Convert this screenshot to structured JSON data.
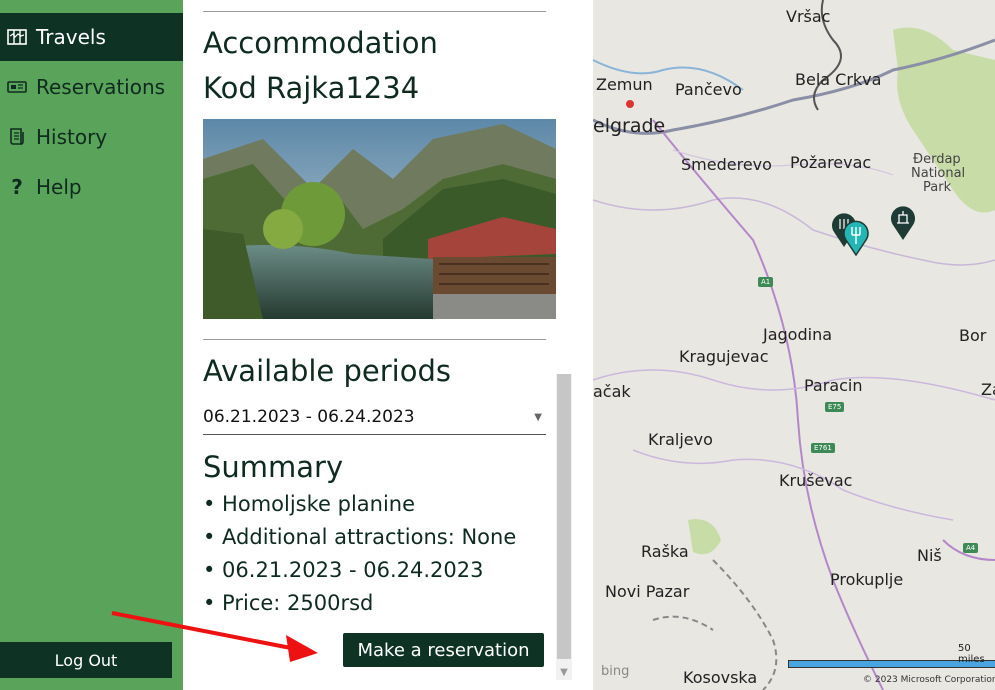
{
  "sidebar": {
    "items": [
      {
        "label": "Travels",
        "icon": "map-icon",
        "active": true
      },
      {
        "label": "Reservations",
        "icon": "ticket-icon"
      },
      {
        "label": "History",
        "icon": "scroll-icon"
      },
      {
        "label": "Help",
        "icon": "question-icon"
      }
    ],
    "logout_label": "Log Out"
  },
  "details": {
    "section_title": "Accommodation",
    "accommodation_name": "Kod Rajka1234",
    "periods_title": "Available periods",
    "selected_period": "06.21.2023 - 06.24.2023",
    "summary_title": "Summary",
    "summary_lines": [
      "• Homoljske planine",
      "• Additional attractions: None",
      "• 06.21.2023 - 06.24.2023",
      "• Price: 2500rsd"
    ],
    "reserve_label": "Make a reservation"
  },
  "map": {
    "labels": [
      "Vršac",
      "Zemun",
      "Pančevo",
      "Bela Crkva",
      "elgrade",
      "Smederevo",
      "Požarevac",
      "Đerdap",
      "National",
      "Park",
      "A1",
      "Jagodina",
      "Bor",
      "Kragujevac",
      "Paracin",
      "ačak",
      "E75",
      "Kraljevo",
      "E761",
      "Kruševac",
      "Raška",
      "Niš",
      "A4",
      "Prokuplje",
      "Novi Pazar",
      "Kosovska",
      "Za"
    ],
    "attribution": "© 2023 Microsoft Corporation",
    "scale": "50 miles",
    "brand": "bing"
  },
  "colors": {
    "sidebar_bg": "#5aa35a",
    "dark_green": "#0e3325",
    "text_dark": "#0f2b1f"
  }
}
